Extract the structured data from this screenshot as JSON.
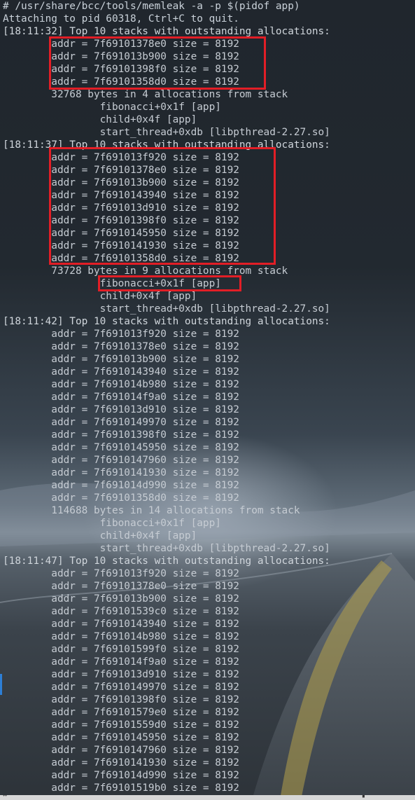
{
  "terminal": {
    "lines": [
      {
        "kind": "cmd",
        "text": "# /usr/share/bcc/tools/memleak -a -p $(pidof app)"
      },
      {
        "kind": "info",
        "text": "Attaching to pid 60318, Ctrl+C to quit."
      },
      {
        "kind": "header",
        "text": "[18:11:32] Top 10 stacks with outstanding allocations:"
      },
      {
        "kind": "addr",
        "text": "        addr = 7f69101378e0 size = 8192"
      },
      {
        "kind": "addr",
        "text": "        addr = 7f691013b900 size = 8192"
      },
      {
        "kind": "addr",
        "text": "        addr = 7f69101398f0 size = 8192"
      },
      {
        "kind": "addr",
        "text": "        addr = 7f69101358d0 size = 8192"
      },
      {
        "kind": "summary",
        "text": "        32768 bytes in 4 allocations from stack"
      },
      {
        "kind": "frame",
        "text": "                fibonacci+0x1f [app]"
      },
      {
        "kind": "frame",
        "text": "                child+0x4f [app]"
      },
      {
        "kind": "frame",
        "text": "                start_thread+0xdb [libpthread-2.27.so]"
      },
      {
        "kind": "header",
        "text": "[18:11:37] Top 10 stacks with outstanding allocations:"
      },
      {
        "kind": "addr",
        "text": "        addr = 7f691013f920 size = 8192"
      },
      {
        "kind": "addr",
        "text": "        addr = 7f69101378e0 size = 8192"
      },
      {
        "kind": "addr",
        "text": "        addr = 7f691013b900 size = 8192"
      },
      {
        "kind": "addr",
        "text": "        addr = 7f6910143940 size = 8192"
      },
      {
        "kind": "addr",
        "text": "        addr = 7f691013d910 size = 8192"
      },
      {
        "kind": "addr",
        "text": "        addr = 7f69101398f0 size = 8192"
      },
      {
        "kind": "addr",
        "text": "        addr = 7f6910145950 size = 8192"
      },
      {
        "kind": "addr",
        "text": "        addr = 7f6910141930 size = 8192"
      },
      {
        "kind": "addr",
        "text": "        addr = 7f69101358d0 size = 8192"
      },
      {
        "kind": "summary",
        "text": "        73728 bytes in 9 allocations from stack"
      },
      {
        "kind": "frame",
        "text": "                fibonacci+0x1f [app]"
      },
      {
        "kind": "frame",
        "text": "                child+0x4f [app]"
      },
      {
        "kind": "frame",
        "text": "                start_thread+0xdb [libpthread-2.27.so]"
      },
      {
        "kind": "header",
        "text": "[18:11:42] Top 10 stacks with outstanding allocations:"
      },
      {
        "kind": "addr",
        "text": "        addr = 7f691013f920 size = 8192"
      },
      {
        "kind": "addr",
        "text": "        addr = 7f69101378e0 size = 8192"
      },
      {
        "kind": "addr",
        "text": "        addr = 7f691013b900 size = 8192"
      },
      {
        "kind": "addr",
        "text": "        addr = 7f6910143940 size = 8192"
      },
      {
        "kind": "addr",
        "text": "        addr = 7f691014b980 size = 8192"
      },
      {
        "kind": "addr",
        "text": "        addr = 7f691014f9a0 size = 8192"
      },
      {
        "kind": "addr",
        "text": "        addr = 7f691013d910 size = 8192"
      },
      {
        "kind": "addr",
        "text": "        addr = 7f6910149970 size = 8192"
      },
      {
        "kind": "addr",
        "text": "        addr = 7f69101398f0 size = 8192"
      },
      {
        "kind": "addr",
        "text": "        addr = 7f6910145950 size = 8192"
      },
      {
        "kind": "addr",
        "text": "        addr = 7f6910147960 size = 8192"
      },
      {
        "kind": "addr",
        "text": "        addr = 7f6910141930 size = 8192"
      },
      {
        "kind": "addr",
        "text": "        addr = 7f691014d990 size = 8192"
      },
      {
        "kind": "addr",
        "text": "        addr = 7f69101358d0 size = 8192"
      },
      {
        "kind": "summary",
        "text": "        114688 bytes in 14 allocations from stack"
      },
      {
        "kind": "frame",
        "text": "                fibonacci+0x1f [app]"
      },
      {
        "kind": "frame",
        "text": "                child+0x4f [app]"
      },
      {
        "kind": "frame",
        "text": "                start_thread+0xdb [libpthread-2.27.so]"
      },
      {
        "kind": "header",
        "text": "[18:11:47] Top 10 stacks with outstanding allocations:"
      },
      {
        "kind": "addr",
        "text": "        addr = 7f691013f920 size = 8192"
      },
      {
        "kind": "addr",
        "text": "        addr = 7f69101378e0 size = 8192"
      },
      {
        "kind": "addr",
        "text": "        addr = 7f691013b900 size = 8192"
      },
      {
        "kind": "addr",
        "text": "        addr = 7f69101539c0 size = 8192"
      },
      {
        "kind": "addr",
        "text": "        addr = 7f6910143940 size = 8192"
      },
      {
        "kind": "addr",
        "text": "        addr = 7f691014b980 size = 8192"
      },
      {
        "kind": "addr",
        "text": "        addr = 7f69101599f0 size = 8192"
      },
      {
        "kind": "addr",
        "text": "        addr = 7f691014f9a0 size = 8192"
      },
      {
        "kind": "addr",
        "text": "        addr = 7f691013d910 size = 8192"
      },
      {
        "kind": "addr",
        "text": "        addr = 7f6910149970 size = 8192"
      },
      {
        "kind": "addr",
        "text": "        addr = 7f69101398f0 size = 8192"
      },
      {
        "kind": "addr",
        "text": "        addr = 7f69101579e0 size = 8192"
      },
      {
        "kind": "addr",
        "text": "        addr = 7f69101559d0 size = 8192"
      },
      {
        "kind": "addr",
        "text": "        addr = 7f6910145950 size = 8192"
      },
      {
        "kind": "addr",
        "text": "        addr = 7f6910147960 size = 8192"
      },
      {
        "kind": "addr",
        "text": "        addr = 7f6910141930 size = 8192"
      },
      {
        "kind": "addr",
        "text": "        addr = 7f691014d990 size = 8192"
      },
      {
        "kind": "addr",
        "text": "        addr = 7f69101519b0 size = 8192"
      }
    ]
  },
  "highlight_color": "#e21e26",
  "text_color": "#c9d1d9"
}
